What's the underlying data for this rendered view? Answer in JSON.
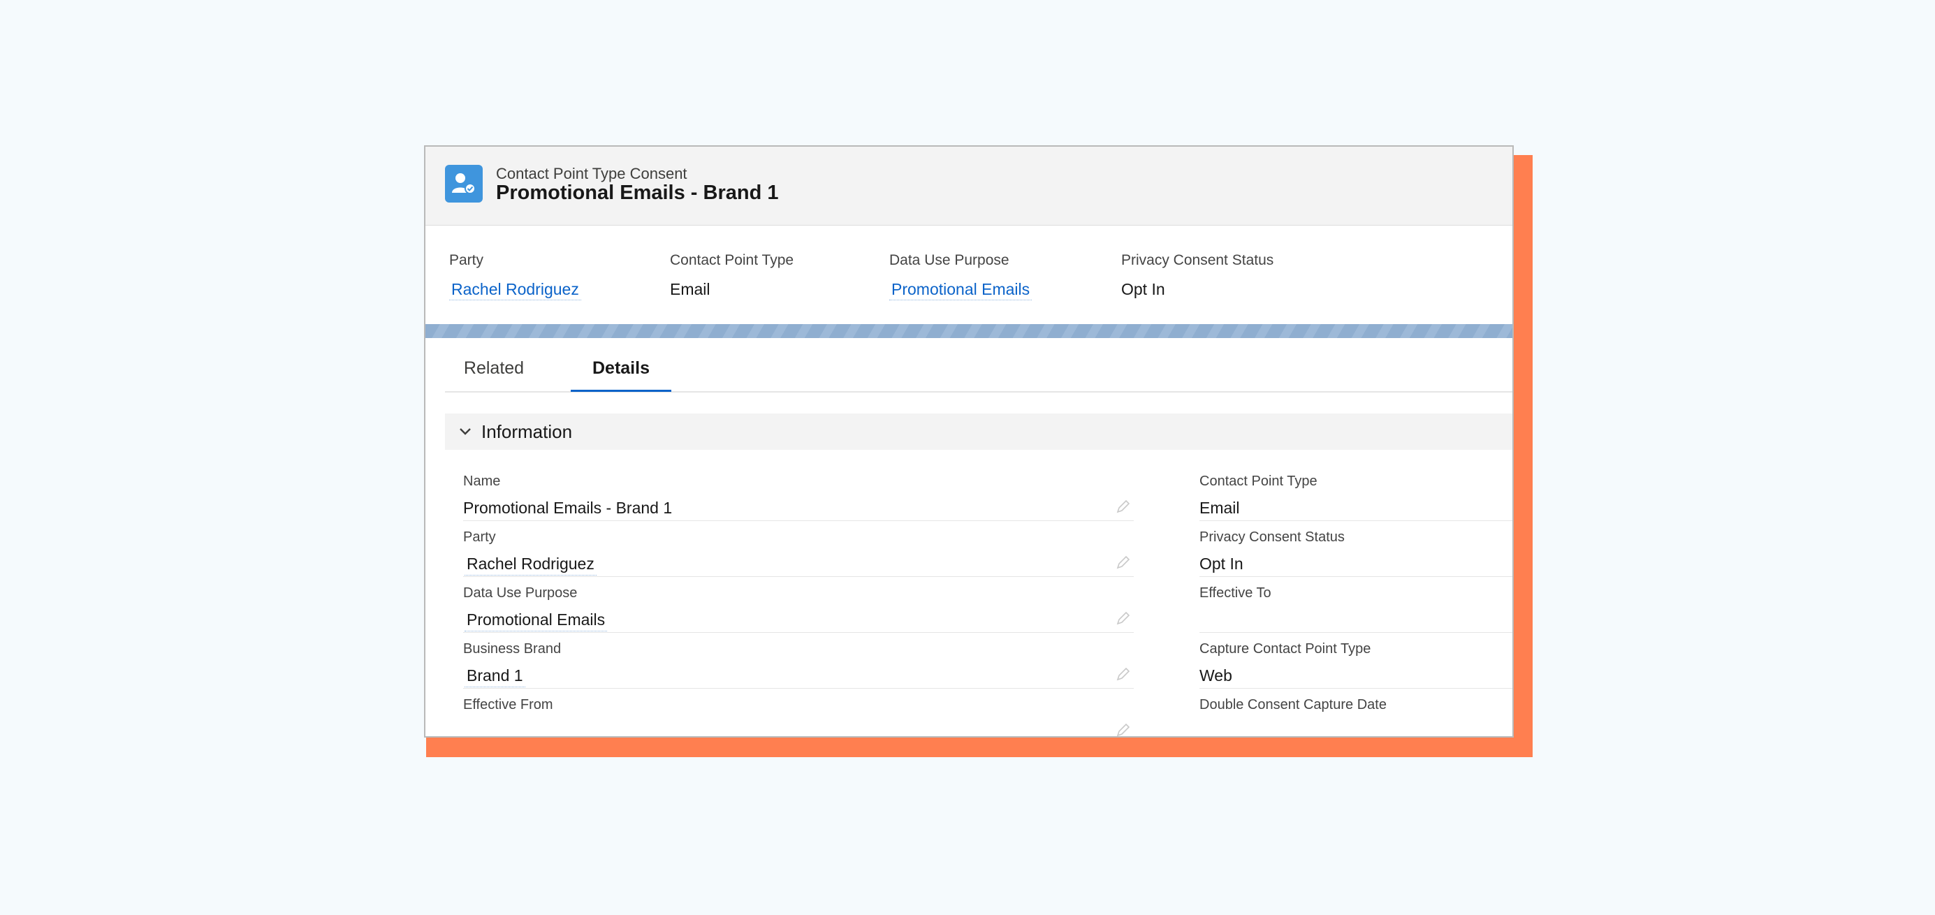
{
  "record": {
    "object_type": "Contact Point Type Consent",
    "title": "Promotional Emails - Brand 1",
    "icon": "consent-person-icon",
    "accent_color": "#3f95dd"
  },
  "highlights": [
    {
      "label": "Party",
      "value": "Rachel Rodriguez",
      "is_link": true
    },
    {
      "label": "Contact Point Type",
      "value": "Email",
      "is_link": false
    },
    {
      "label": "Data Use Purpose",
      "value": "Promotional Emails",
      "is_link": true
    },
    {
      "label": "Privacy Consent Status",
      "value": "Opt In",
      "is_link": false
    }
  ],
  "tabs": [
    {
      "label": "Related",
      "active": false
    },
    {
      "label": "Details",
      "active": true
    }
  ],
  "section": {
    "title": "Information",
    "icon": "chevron-down-icon"
  },
  "left_fields": [
    {
      "label": "Name",
      "value": "Promotional Emails - Brand 1",
      "is_link": false
    },
    {
      "label": "Party",
      "value": "Rachel Rodriguez",
      "is_link": true
    },
    {
      "label": "Data Use Purpose",
      "value": "Promotional Emails",
      "is_link": true
    },
    {
      "label": "Business Brand",
      "value": "Brand 1",
      "is_link": true
    },
    {
      "label": "Effective From",
      "value": "",
      "is_link": false
    }
  ],
  "right_fields": [
    {
      "label": "Contact Point Type",
      "value": "Email"
    },
    {
      "label": "Privacy Consent Status",
      "value": "Opt In"
    },
    {
      "label": "Effective To",
      "value": ""
    },
    {
      "label": "Capture Contact Point Type",
      "value": "Web"
    },
    {
      "label": "Double Consent Capture Date",
      "value": ""
    }
  ],
  "colors": {
    "link": "#0b63c9",
    "frame": "#ff7f50",
    "background": "#f5fafd"
  }
}
